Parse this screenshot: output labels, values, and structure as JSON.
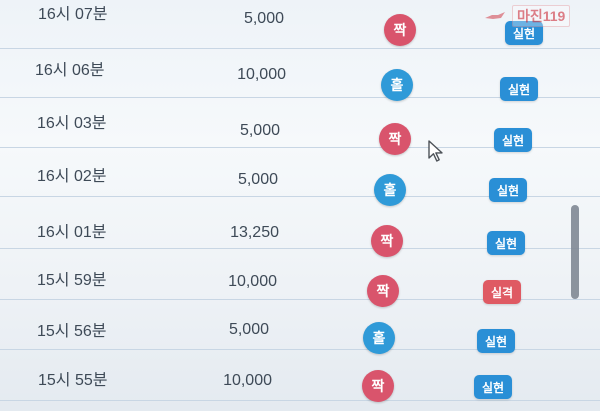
{
  "watermark": {
    "brand_text": "마진119"
  },
  "rows": [
    {
      "time": "16시 07분",
      "amount": "5,000",
      "pick": "짝",
      "result": "실현"
    },
    {
      "time": "16시 06분",
      "amount": "10,000",
      "pick": "홀",
      "result": "실현"
    },
    {
      "time": "16시 03분",
      "amount": "5,000",
      "pick": "짝",
      "result": "실현"
    },
    {
      "time": "16시 02분",
      "amount": "5,000",
      "pick": "홀",
      "result": "실현"
    },
    {
      "time": "16시 01분",
      "amount": "13,250",
      "pick": "짝",
      "result": "실현"
    },
    {
      "time": "15시 59분",
      "amount": "10,000",
      "pick": "짝",
      "result": "실격"
    },
    {
      "time": "15시 56분",
      "amount": "5,000",
      "pick": "홀",
      "result": "실현"
    },
    {
      "time": "15시 55분",
      "amount": "10,000",
      "pick": "짝",
      "result": "실현"
    }
  ],
  "colors": {
    "odd_pick": "#d9546c",
    "even_pick": "#2f9ad8",
    "win_badge": "#2a8fd6",
    "lose_badge": "#df5a63"
  },
  "icons": {
    "cursor": "mouse-pointer-icon",
    "watermark": "brand-watermark-icon"
  }
}
